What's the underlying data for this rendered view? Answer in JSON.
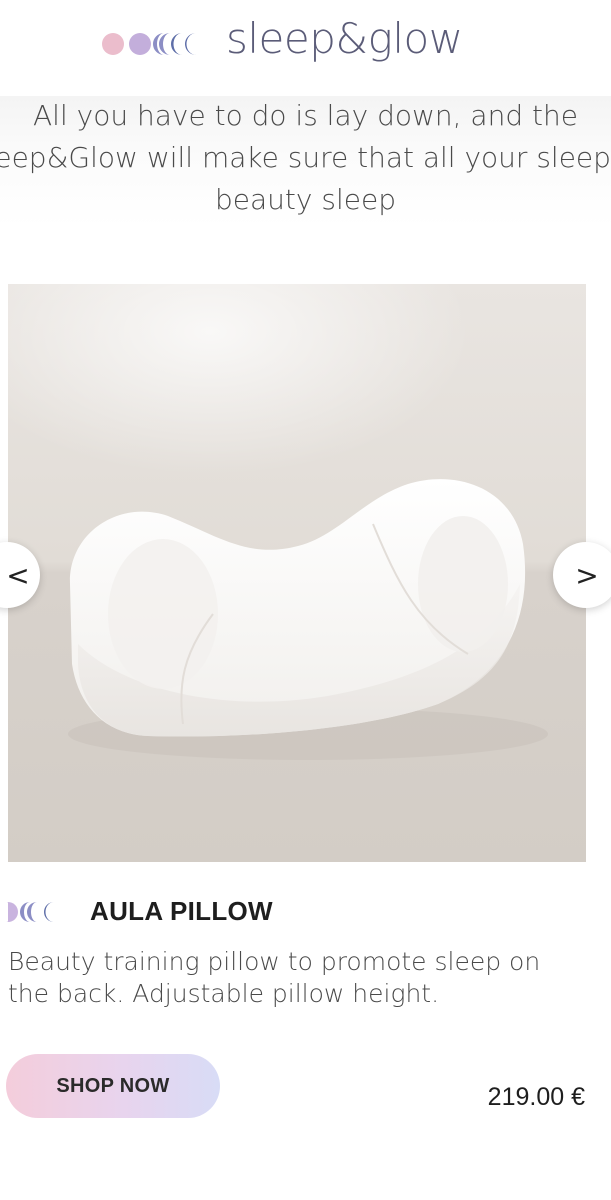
{
  "header": {
    "logo_text": "sleep&glow"
  },
  "intro": {
    "line1": "All you have to do is lay down, and the",
    "line2": "Sleep&Glow will make sure that all your sleep is",
    "line3": "beauty sleep"
  },
  "carousel": {
    "prev_icon": "chevron-left-icon",
    "next_icon": "chevron-right-icon",
    "prev_glyph": "<",
    "next_glyph": ">"
  },
  "product": {
    "title": "AULA PILLOW",
    "description": "Beauty training pillow to promote sleep on the back. Adjustable pillow height.",
    "cta_label": "SHOP NOW",
    "price": "219.00 €"
  },
  "colors": {
    "logo_text": "#5b5c78",
    "moon_pink": "#e9b7c8",
    "moon_lilac": "#b9a8d6",
    "moon_blue": "#5e6ea8",
    "button_gradient_start": "#f4cddb",
    "button_gradient_end": "#d8dcf6"
  }
}
